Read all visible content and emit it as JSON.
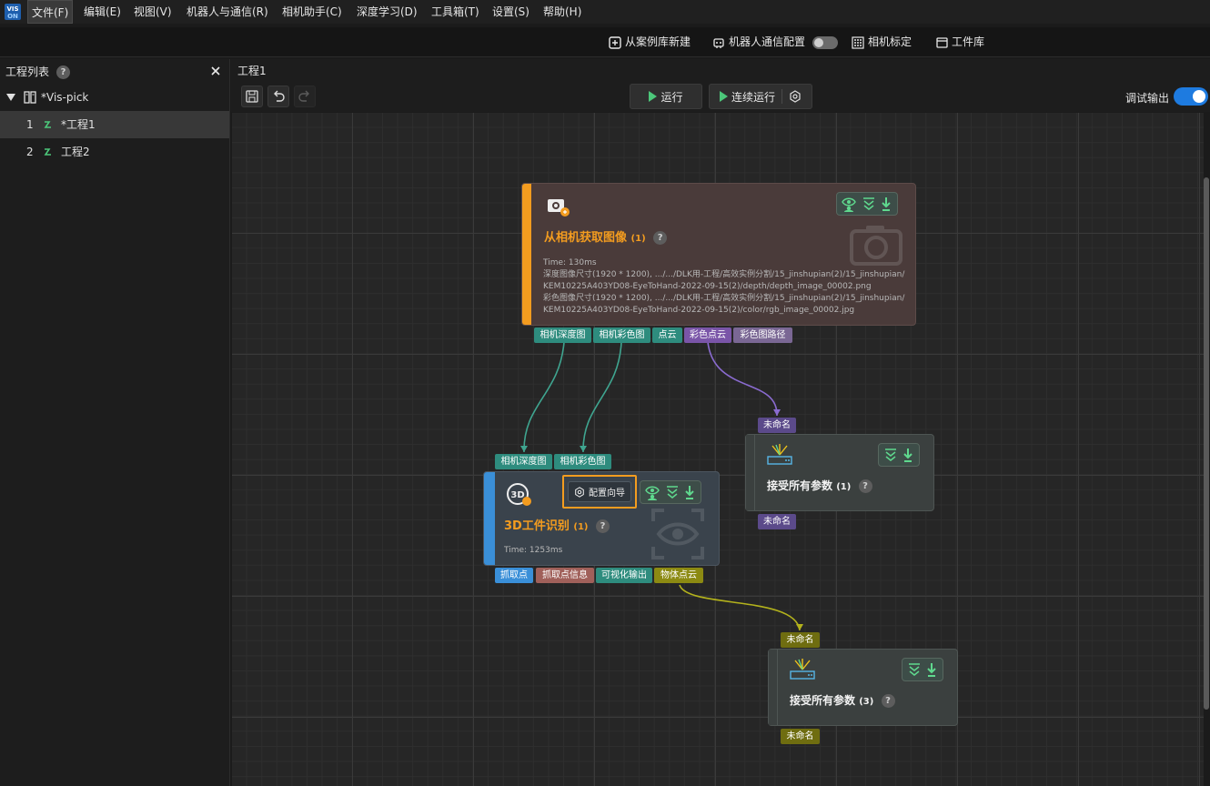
{
  "menubar": {
    "items": [
      "文件(F)",
      "编辑(E)",
      "视图(V)",
      "机器人与通信(R)",
      "相机助手(C)",
      "深度学习(D)",
      "工具箱(T)",
      "设置(S)",
      "帮助(H)"
    ]
  },
  "toolbar": {
    "new_from_case": "从案例库新建",
    "robot_comm_config": "机器人通信配置",
    "camera_calibration": "相机标定",
    "workpiece_library": "工件库"
  },
  "project_panel": {
    "title": "工程列表",
    "help": "?",
    "solution": "*Vis-pick",
    "projects": [
      {
        "index": "1",
        "name": "*工程1"
      },
      {
        "index": "2",
        "name": "工程2"
      }
    ]
  },
  "editor": {
    "tab": "工程1",
    "run_label": "运行",
    "continuous_run_label": "连续运行",
    "debug_output_label": "调试输出"
  },
  "nodes": {
    "capture": {
      "title": "从相机获取图像",
      "count": "(1)",
      "time": "Time: 130ms",
      "lines": [
        "深度图像尺寸(1920 * 1200), .../.../DLK用-工程/高效实例分割/15_jinshupian(2)/15_jinshupian/",
        "KEM10225A403YD08-EyeToHand-2022-09-15(2)/depth/depth_image_00002.png",
        "彩色图像尺寸(1920 * 1200), .../.../DLK用-工程/高效实例分割/15_jinshupian(2)/15_jinshupian/",
        "KEM10225A403YD08-EyeToHand-2022-09-15(2)/color/rgb_image_00002.jpg"
      ],
      "outputs": [
        "相机深度图",
        "相机彩色图",
        "点云",
        "彩色点云",
        "彩色图路径"
      ]
    },
    "recognition": {
      "title": "3D工件识别",
      "count": "(1)",
      "time": "Time: 1253ms",
      "config_wizard": "配置向导",
      "inputs": [
        "相机深度图",
        "相机彩色图"
      ],
      "outputs": [
        "抓取点",
        "抓取点信息",
        "可视化输出",
        "物体点云"
      ]
    },
    "receive1": {
      "title": "接受所有参数",
      "count": "(1)",
      "input": "未命名",
      "output": "未命名"
    },
    "receive3": {
      "title": "接受所有参数",
      "count": "(3)",
      "input": "未命名",
      "output": "未命名"
    }
  },
  "colors": {
    "accent_orange": "#f39c1f",
    "accent_blue": "#3a8fd8",
    "port_teal": "#2e8c7e",
    "port_purple": "#7a55a8",
    "port_olive": "#8c8a12",
    "toggle_on": "#1e7be0"
  }
}
